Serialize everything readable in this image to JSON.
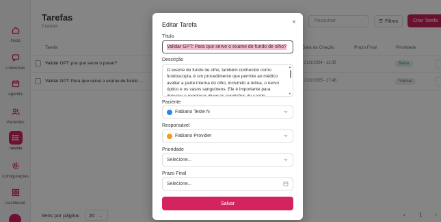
{
  "sidebar": {
    "items": [
      {
        "label": "Início",
        "icon": "home-icon"
      },
      {
        "label": "Conversas",
        "icon": "chat-icon"
      },
      {
        "label": "Agenda",
        "icon": "calendar-icon"
      },
      {
        "label": "Pacientes",
        "icon": "users-icon"
      },
      {
        "label": "Tarefas",
        "icon": "list-icon"
      },
      {
        "label": "Configurações",
        "icon": "gear-icon"
      },
      {
        "label": "Dashboard",
        "icon": "grid-icon"
      }
    ],
    "active_color": "#d4245f"
  },
  "page": {
    "title": "Tarefas",
    "subtitle": "2 tarefas",
    "search_placeholder": "Pesquisar",
    "filter_label": "Filtros",
    "create_label": "Criar Tarefa"
  },
  "table": {
    "headers": {
      "task": "Tarefa",
      "created": "Data da Criação",
      "due": "Prazo Final",
      "priority": "Prioridade"
    },
    "rows": [
      {
        "task": "Validar GPT: pra que serve o puran?",
        "created": "21/1/2024 - 11:05",
        "priority": "Baixa"
      },
      {
        "task": "Validar GPT: Para que serve o exame de fundo ...",
        "created": "21/1/2025 - 17:48",
        "priority": "Normal"
      }
    ]
  },
  "footer": {
    "per_page_label": "Itens por página:",
    "per_page_value": "20",
    "page_number": "1",
    "prev": "‹",
    "next": "›"
  },
  "modal": {
    "title": "Editar Tarefa",
    "close": "×",
    "title_label": "Título",
    "title_value": "Validar GPT: Para que serve o exame de fundo de olho?",
    "description_label": "Descrição",
    "description_value": "O exame de fundo de olho, também conhecido como fundoscopia, é um procedimento que permite ao médico avaliar a parte interna do olho, incluindo a retina, o nervo óptico e os vasos sanguíneos. Ele é importante para detectar e monitorar diversas condições de saúde",
    "patient_label": "Paciente",
    "patient_value": "Fabiano Teste N",
    "responsible_label": "Responsável",
    "responsible_value": "Fabiano Provider",
    "priority_label": "Prioridade",
    "priority_placeholder": "Selecione...",
    "due_label": "Prazo Final",
    "due_placeholder": "Selecione...",
    "save_label": "Salvar"
  }
}
